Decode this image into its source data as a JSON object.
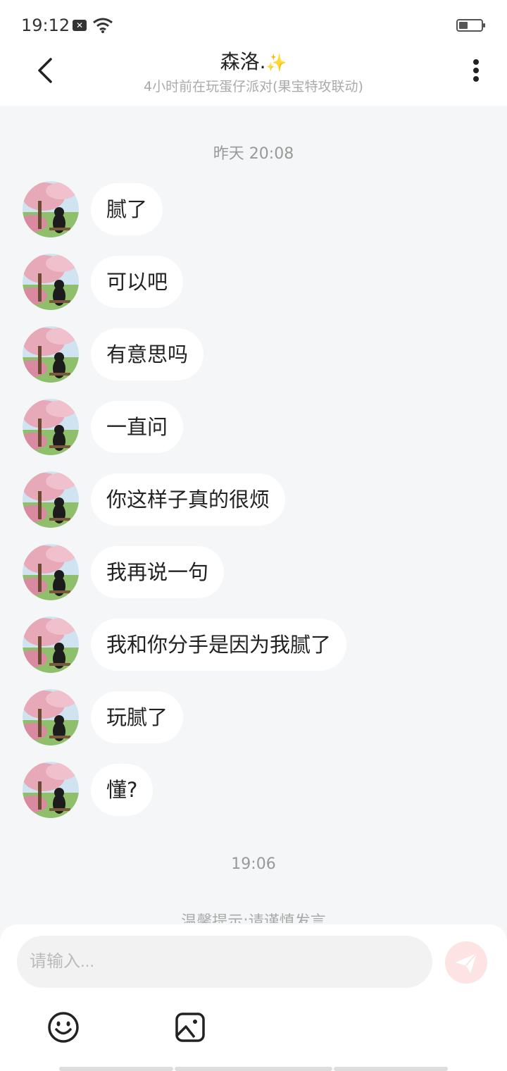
{
  "status": {
    "time": "19:12",
    "battery_level": 0.4
  },
  "header": {
    "title": "森洛.",
    "sparkle": "✨",
    "subtitle": "4小时前在玩蛋仔派对(果宝特攻联动)"
  },
  "chat": {
    "timestamp_1": "昨天 20:08",
    "messages": [
      {
        "text": "腻了"
      },
      {
        "text": "可以吧"
      },
      {
        "text": "有意思吗"
      },
      {
        "text": "一直问"
      },
      {
        "text": "你这样子真的很烦"
      },
      {
        "text": "我再说一句"
      },
      {
        "text": "我和你分手是因为我腻了"
      },
      {
        "text": "玩腻了"
      },
      {
        "text": "懂?"
      }
    ],
    "timestamp_2": "19:06",
    "warning": "温馨提示:请谨慎发言"
  },
  "input": {
    "placeholder": "请输入..."
  },
  "colors": {
    "accent": "#f47b80",
    "send_bg": "#fde3e4",
    "page_bg": "#f4f6f7"
  }
}
